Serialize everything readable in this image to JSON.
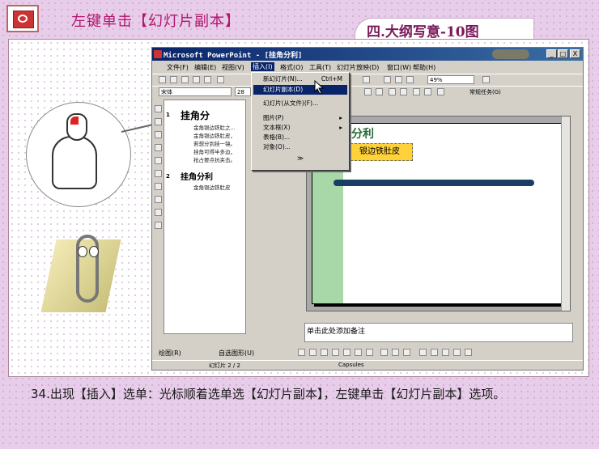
{
  "header": {
    "title": "左键单击【幻灯片副本】",
    "right_title": "四.大纲写意-10图"
  },
  "window": {
    "title": "Microsoft PowerPoint - [挂角分利]",
    "assistant_badge": "",
    "controls": [
      "_",
      "□",
      "X"
    ]
  },
  "menubar": {
    "items": [
      "文件(F)",
      "编辑(E)",
      "视图(V)",
      "插入(I)",
      "格式(O)",
      "工具(T)",
      "幻灯片放映(D)",
      "窗口(W)",
      "帮助(H)"
    ],
    "active_index": 3
  },
  "toolbar": {
    "font_name": "宋体",
    "font_size": "28",
    "zoom": "49%",
    "task_label": "常规任务(G)"
  },
  "insert_menu": {
    "items": [
      {
        "label": "新幻灯片(N)...",
        "shortcut": "Ctrl+M"
      },
      {
        "label": "幻灯片副本(D)",
        "shortcut": ""
      },
      {
        "label": "幻灯片(从文件)(F)...",
        "shortcut": ""
      },
      {
        "label": "图片(P)",
        "shortcut": ""
      },
      {
        "label": "文本框(X)",
        "shortcut": ""
      },
      {
        "label": "表格(B)...",
        "shortcut": ""
      },
      {
        "label": "对象(O)...",
        "shortcut": ""
      },
      {
        "label": "≫",
        "shortcut": ""
      }
    ],
    "selected_index": 1
  },
  "outline": {
    "slide1_num": "1",
    "slide1_title": "挂角分",
    "slide1_bullets": [
      "金角银边铁肚之...",
      "金角银边铁肚皮，",
      "若想分到挂一镜。",
      "挂角可得半多边，",
      "抢占要点抗夹击。"
    ],
    "slide2_num": "2",
    "slide2_title": "挂角分利",
    "slide2_bullets": [
      "金角银边铁肚皮"
    ]
  },
  "slide": {
    "title": "分利",
    "textbox": "银边铁肚皮"
  },
  "notes": {
    "placeholder": "单击此处添加备注"
  },
  "drawing_toolbar": {
    "draw_label": "绘图(R)",
    "autoshape_label": "自选图形(U)"
  },
  "status": {
    "slide_pos": "幻灯片 2 / 2",
    "template": "Capsules"
  },
  "caption": {
    "text": "34.出现【插入】选单：光标顺着选单选【幻灯片副本】，左键单击【幻灯片副本】选项。"
  }
}
